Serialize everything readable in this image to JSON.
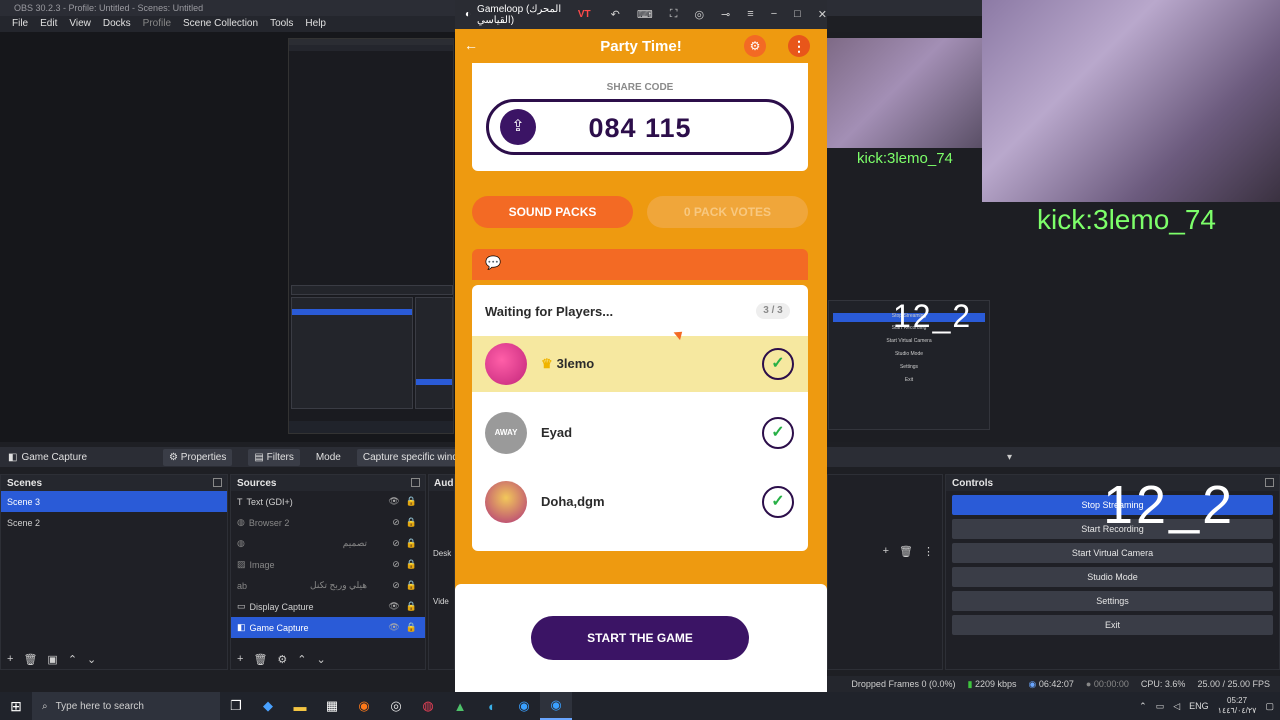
{
  "obs": {
    "title": "OBS 30.2.3 - Profile: Untitled - Scenes: Untitled",
    "menu": [
      "File",
      "Edit",
      "View",
      "Docks",
      "Profile",
      "Scene Collection",
      "Tools",
      "Help"
    ],
    "source_bar": {
      "source_name": "Game Capture",
      "properties_label": "Properties",
      "filters_label": "Filters",
      "mode_label": "Mode",
      "mode_value": "Capture specific window"
    },
    "scenes": {
      "header": "Scenes",
      "items": [
        "Scene 3",
        "Scene 2"
      ]
    },
    "sources": {
      "header": "Sources",
      "items": [
        "Text (GDI+)",
        "Browser 2",
        "تصميم",
        "Image",
        "هيلي وربح تكنل",
        "Display Capture",
        "Game Capture"
      ]
    },
    "audio": {
      "header": "Aud",
      "labels": [
        "Desk",
        "Vide"
      ]
    },
    "controls": {
      "header": "Controls",
      "buttons": [
        "Stop Streaming",
        "Start Recording",
        "Start Virtual Camera",
        "Studio Mode",
        "Settings",
        "Exit"
      ]
    },
    "status": {
      "dropped": "Dropped Frames 0 (0.0%)",
      "bitrate": "2209 kbps",
      "stream_time": "06:42:07",
      "rec_time": "00:00:00",
      "cpu": "CPU: 3.6%",
      "fps": "25.00 / 25.00 FPS"
    }
  },
  "overlay": {
    "kick_label": "kick:3lemo_74",
    "score_text": "12_2"
  },
  "gameloop": {
    "window_title": "Gameloop (المحرك القياسي)",
    "vt_badge": "VT"
  },
  "app": {
    "title": "Party Time!",
    "share_code_label": "SHARE CODE",
    "share_code": "084 115",
    "sound_packs_label": "SOUND PACKS",
    "pack_votes_label": "0 PACK VOTES",
    "waiting_title": "Waiting for Players...",
    "player_count": "3 / 3",
    "players": [
      {
        "name": "3lemo",
        "host": true,
        "avatar_label": ""
      },
      {
        "name": "Eyad",
        "host": false,
        "avatar_label": "AWAY"
      },
      {
        "name": "Doha,dgm",
        "host": false,
        "avatar_label": ""
      }
    ],
    "start_label": "START THE GAME"
  },
  "taskbar": {
    "search_placeholder": "Type here to search",
    "tray_lang": "ENG",
    "time": "05:27",
    "date": "١٤٤٦/٠٤/٢٧"
  }
}
